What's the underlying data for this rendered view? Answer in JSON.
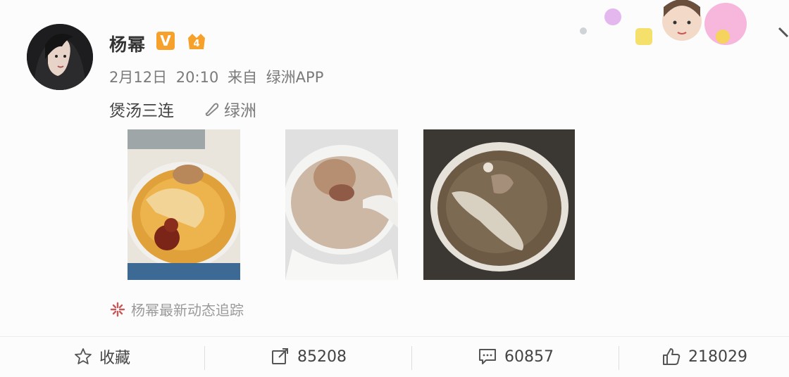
{
  "post": {
    "username": "杨幂",
    "verified_badge": "V",
    "level_badge": "4",
    "date": "2月12日",
    "time": "20:10",
    "source_prefix": "来自",
    "source": "绿洲APP",
    "text": "煲汤三连",
    "location": "绿洲",
    "tracker_text": "杨幂最新动态追踪"
  },
  "actions": {
    "favorite_label": "收藏",
    "repost_count": "85208",
    "comment_count": "60857",
    "like_count": "218029"
  },
  "colors": {
    "badge_orange": "#f6a12b",
    "muted_text": "#7a7a7a"
  }
}
